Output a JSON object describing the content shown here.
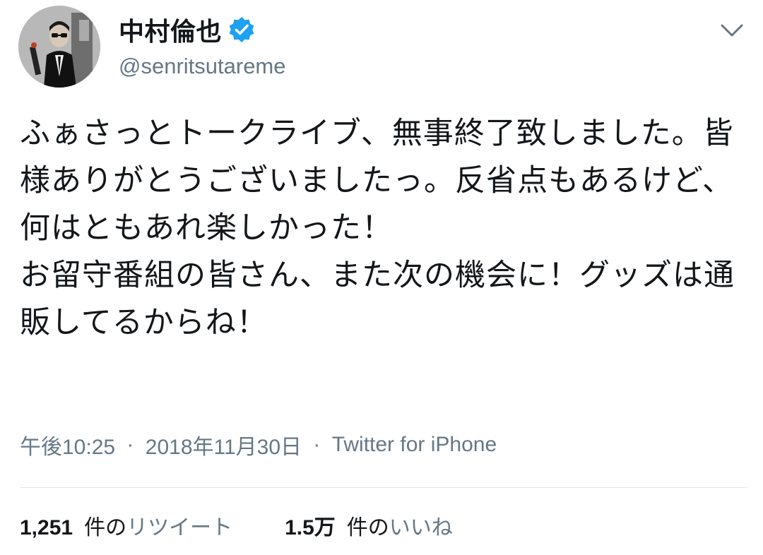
{
  "user": {
    "display_name": "中村倫也",
    "handle": "@senritsutareme",
    "verified": true
  },
  "tweet": {
    "text": "ふぁさっとトークライブ、無事終了致しました。皆様ありがとうございましたっ。反省点もあるけど、何はともあれ楽しかった！\nお留守番組の皆さん、また次の機会に！グッズは通販してるからね！",
    "time": "午後10:25",
    "separator": "·",
    "date": "2018年11月30日",
    "source": "Twitter for iPhone"
  },
  "stats": {
    "retweets": {
      "count": "1,251",
      "unit": "件の",
      "label": "リツイート"
    },
    "likes": {
      "count": "1.5万",
      "unit": "件の",
      "label": "いいね"
    }
  },
  "icons": {
    "verified": "verified-badge-icon",
    "caret": "chevron-down-icon"
  },
  "colors": {
    "verified_blue": "#1da1f2",
    "secondary_text": "#657786",
    "primary_text": "#14171a"
  }
}
